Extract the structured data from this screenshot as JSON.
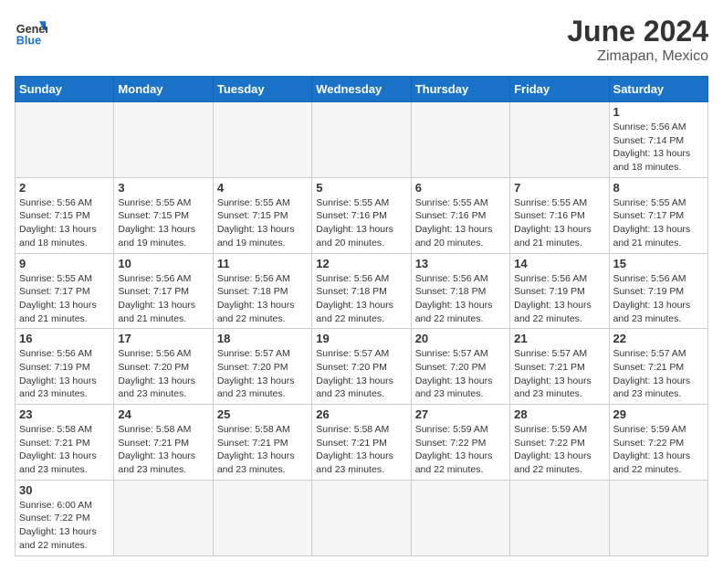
{
  "header": {
    "logo_general": "General",
    "logo_blue": "Blue",
    "title": "June 2024",
    "subtitle": "Zimapan, Mexico"
  },
  "weekdays": [
    "Sunday",
    "Monday",
    "Tuesday",
    "Wednesday",
    "Thursday",
    "Friday",
    "Saturday"
  ],
  "days": {
    "1": {
      "sunrise": "5:56 AM",
      "sunset": "7:14 PM",
      "daylight": "13 hours and 18 minutes."
    },
    "2": {
      "sunrise": "5:56 AM",
      "sunset": "7:15 PM",
      "daylight": "13 hours and 18 minutes."
    },
    "3": {
      "sunrise": "5:55 AM",
      "sunset": "7:15 PM",
      "daylight": "13 hours and 19 minutes."
    },
    "4": {
      "sunrise": "5:55 AM",
      "sunset": "7:15 PM",
      "daylight": "13 hours and 19 minutes."
    },
    "5": {
      "sunrise": "5:55 AM",
      "sunset": "7:16 PM",
      "daylight": "13 hours and 20 minutes."
    },
    "6": {
      "sunrise": "5:55 AM",
      "sunset": "7:16 PM",
      "daylight": "13 hours and 20 minutes."
    },
    "7": {
      "sunrise": "5:55 AM",
      "sunset": "7:16 PM",
      "daylight": "13 hours and 21 minutes."
    },
    "8": {
      "sunrise": "5:55 AM",
      "sunset": "7:17 PM",
      "daylight": "13 hours and 21 minutes."
    },
    "9": {
      "sunrise": "5:55 AM",
      "sunset": "7:17 PM",
      "daylight": "13 hours and 21 minutes."
    },
    "10": {
      "sunrise": "5:56 AM",
      "sunset": "7:17 PM",
      "daylight": "13 hours and 21 minutes."
    },
    "11": {
      "sunrise": "5:56 AM",
      "sunset": "7:18 PM",
      "daylight": "13 hours and 22 minutes."
    },
    "12": {
      "sunrise": "5:56 AM",
      "sunset": "7:18 PM",
      "daylight": "13 hours and 22 minutes."
    },
    "13": {
      "sunrise": "5:56 AM",
      "sunset": "7:18 PM",
      "daylight": "13 hours and 22 minutes."
    },
    "14": {
      "sunrise": "5:56 AM",
      "sunset": "7:19 PM",
      "daylight": "13 hours and 22 minutes."
    },
    "15": {
      "sunrise": "5:56 AM",
      "sunset": "7:19 PM",
      "daylight": "13 hours and 23 minutes."
    },
    "16": {
      "sunrise": "5:56 AM",
      "sunset": "7:19 PM",
      "daylight": "13 hours and 23 minutes."
    },
    "17": {
      "sunrise": "5:56 AM",
      "sunset": "7:20 PM",
      "daylight": "13 hours and 23 minutes."
    },
    "18": {
      "sunrise": "5:57 AM",
      "sunset": "7:20 PM",
      "daylight": "13 hours and 23 minutes."
    },
    "19": {
      "sunrise": "5:57 AM",
      "sunset": "7:20 PM",
      "daylight": "13 hours and 23 minutes."
    },
    "20": {
      "sunrise": "5:57 AM",
      "sunset": "7:20 PM",
      "daylight": "13 hours and 23 minutes."
    },
    "21": {
      "sunrise": "5:57 AM",
      "sunset": "7:21 PM",
      "daylight": "13 hours and 23 minutes."
    },
    "22": {
      "sunrise": "5:57 AM",
      "sunset": "7:21 PM",
      "daylight": "13 hours and 23 minutes."
    },
    "23": {
      "sunrise": "5:58 AM",
      "sunset": "7:21 PM",
      "daylight": "13 hours and 23 minutes."
    },
    "24": {
      "sunrise": "5:58 AM",
      "sunset": "7:21 PM",
      "daylight": "13 hours and 23 minutes."
    },
    "25": {
      "sunrise": "5:58 AM",
      "sunset": "7:21 PM",
      "daylight": "13 hours and 23 minutes."
    },
    "26": {
      "sunrise": "5:58 AM",
      "sunset": "7:21 PM",
      "daylight": "13 hours and 23 minutes."
    },
    "27": {
      "sunrise": "5:59 AM",
      "sunset": "7:22 PM",
      "daylight": "13 hours and 22 minutes."
    },
    "28": {
      "sunrise": "5:59 AM",
      "sunset": "7:22 PM",
      "daylight": "13 hours and 22 minutes."
    },
    "29": {
      "sunrise": "5:59 AM",
      "sunset": "7:22 PM",
      "daylight": "13 hours and 22 minutes."
    },
    "30": {
      "sunrise": "6:00 AM",
      "sunset": "7:22 PM",
      "daylight": "13 hours and 22 minutes."
    }
  },
  "labels": {
    "sunrise": "Sunrise:",
    "sunset": "Sunset:",
    "daylight": "Daylight:"
  }
}
